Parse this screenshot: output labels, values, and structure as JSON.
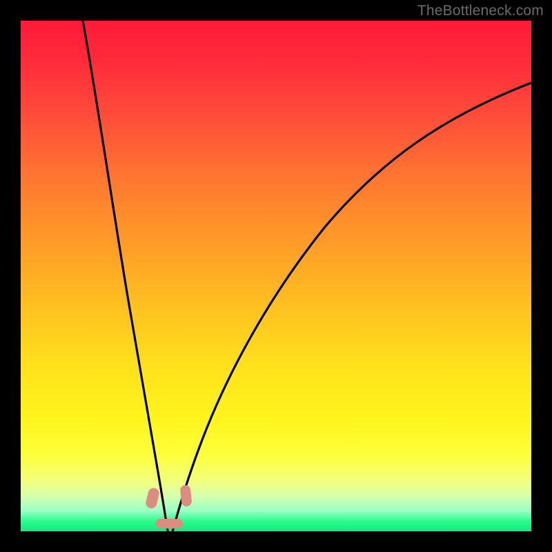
{
  "watermark": "TheBottleneck.com",
  "colors": {
    "background": "#000000",
    "gradient_top": "#ff1a3a",
    "gradient_bottom": "#13e97e",
    "curve": "#000000",
    "marker": "#da8d80",
    "watermark_text": "#6b6b6b"
  },
  "chart_data": {
    "type": "line",
    "title": "",
    "xlabel": "",
    "ylabel": "",
    "xlim": [
      0,
      100
    ],
    "ylim": [
      0,
      100
    ],
    "note": "Axes are unlabeled in the source image; x and y are expressed as percentages of the plot width/height. The chart shows two curves forming a V shape that meet near the bottom, over a vertical red→green gradient background.",
    "series": [
      {
        "name": "left-curve",
        "x": [
          12.2,
          13.5,
          15.5,
          17.6,
          19.6,
          21.6,
          23.0,
          24.3,
          25.7,
          27.0,
          28.4
        ],
        "y": [
          100.0,
          90.0,
          75.0,
          60.0,
          45.0,
          30.0,
          20.0,
          12.0,
          6.0,
          2.0,
          0.0
        ]
      },
      {
        "name": "right-curve",
        "x": [
          29.7,
          32.4,
          35.1,
          40.5,
          47.3,
          54.1,
          62.2,
          70.3,
          78.4,
          86.5,
          93.2,
          100.0
        ],
        "y": [
          0.0,
          5.0,
          12.0,
          25.0,
          38.0,
          48.0,
          58.0,
          66.0,
          73.0,
          79.0,
          83.5,
          87.8
        ]
      }
    ],
    "markers": [
      {
        "name": "left-marker",
        "x": 25.7,
        "y": 6.0,
        "approx_size_pct": 2.4
      },
      {
        "name": "right-marker",
        "x": 32.4,
        "y": 6.0,
        "approx_size_pct": 2.4
      },
      {
        "name": "bottom-marker",
        "x": 29.1,
        "y": 0.5,
        "approx_size_pct_w": 4.5,
        "approx_size_pct_h": 1.6
      }
    ]
  }
}
